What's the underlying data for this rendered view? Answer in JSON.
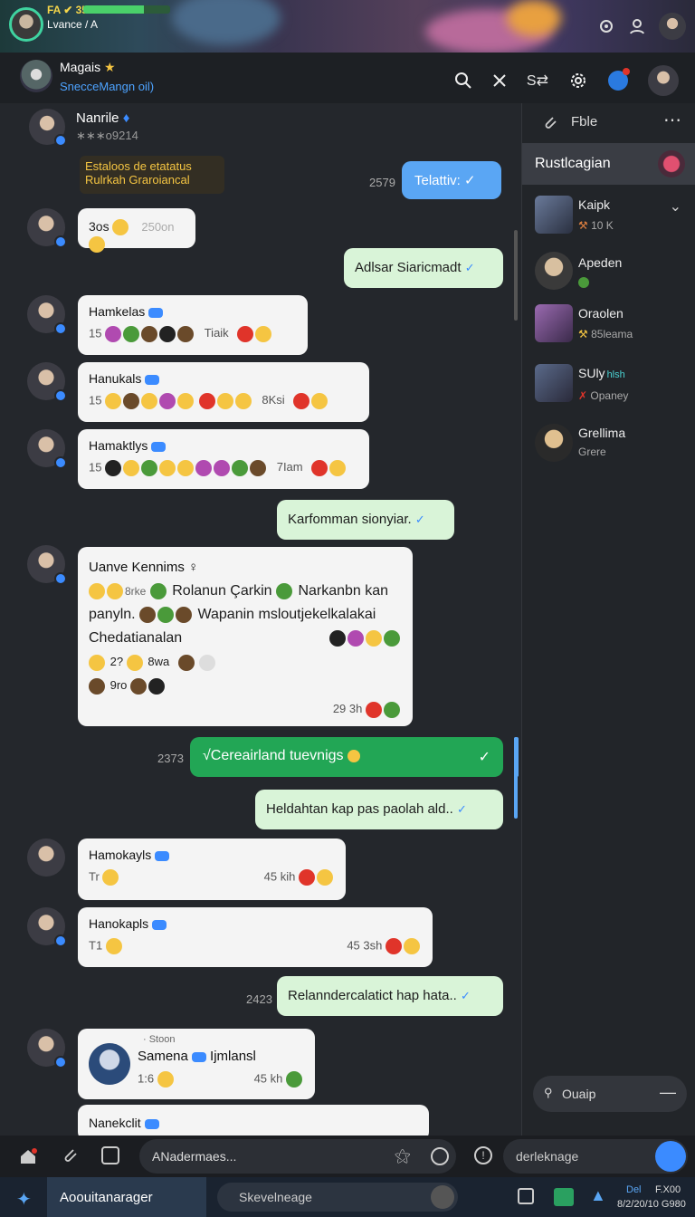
{
  "banner": {
    "stat": "FA ✔ 35823",
    "sub": "Lvance / A"
  },
  "header": {
    "title": "Magais",
    "subtitle": "SnecceMangn oil)"
  },
  "chat": {
    "top_user": {
      "name": "Nanrile",
      "sub": "∗∗∗o9214"
    },
    "system_note": {
      "line1": "Estaloos de etatatus",
      "line2": "Rulrkah Graroiancal"
    },
    "m1": {
      "text": "Telattiv:",
      "time": "2579"
    },
    "m2": {
      "text": "3os",
      "time": "250on"
    },
    "m3": {
      "text": "Adlsar Siaricmadt"
    },
    "m4": {
      "name": "Hamkelas",
      "count": "15",
      "time": "Tiaik"
    },
    "m5": {
      "name": "Hanukals",
      "count": "15",
      "time": "8Ksi"
    },
    "m6": {
      "name": "Hamaktlys",
      "count": "15",
      "time": "7Iam"
    },
    "m7": {
      "text": "Karfomman sionyiar."
    },
    "m8": {
      "name": "Uanve Kennims",
      "line1": "Rolanun Çarkin",
      "line1b": "Narkanbn kan",
      "line2a": "panyln.",
      "line2b": "Wapanin msloutjekelkalakai",
      "line3": "Chedatianalan",
      "line4a": "2?",
      "line4b": "8wa",
      "line5": "9ro",
      "time": "29 3h"
    },
    "m9": {
      "text": "√Cereairland tuevnigs",
      "time": "2373"
    },
    "m10": {
      "text": "Heldahtan kap pas paolah ald.."
    },
    "m11": {
      "name": "Hamokayls",
      "count": "Tr",
      "time": "45 kih"
    },
    "m12": {
      "name": "Hanokapls",
      "count": "T1",
      "time": "45 3sh"
    },
    "m13": {
      "text": "Relanndercalatict hap hata..",
      "time": "2423"
    },
    "m14": {
      "pre": "· Stoon",
      "name": "Samena",
      "extra": "Ijmlansl",
      "count": "1:6",
      "time": "45 kh"
    },
    "m15": {
      "name": "Nanekclit"
    }
  },
  "sidebar": {
    "file_label": "Fble",
    "section": "Rustlcagian",
    "items": [
      {
        "name": "Kaipk",
        "sub": "10 K"
      },
      {
        "name": "Apeden",
        "sub": ""
      },
      {
        "name": "Oraolen",
        "sub": "85leama"
      },
      {
        "name": "SUly",
        "sub": "Opaney",
        "extra": "hlsh"
      },
      {
        "name": "Grellima",
        "sub": "Grere"
      }
    ],
    "bottom_label": "Ouaip"
  },
  "composer": {
    "placeholder": "ANadermaes...",
    "right_placeholder": "derleknage"
  },
  "taskbar": {
    "app": "Aoouitanarager",
    "search": "Skevelneage",
    "clock1": "F.X00",
    "clock2": "8/2/20/10 G980",
    "tray": "Del"
  },
  "colors": {
    "accent": "#3b8bff",
    "bubble_out": "#d9f4d8",
    "bubble_green": "#22a655",
    "bubble_blue": "#5aa6f4"
  }
}
